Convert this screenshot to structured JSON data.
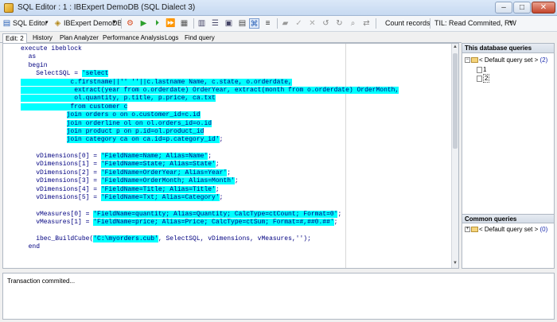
{
  "window": {
    "title": "SQL Editor : 1 : IBExpert DemoDB (SQL Dialect 3)",
    "min": "–",
    "max": "□",
    "close": "✕"
  },
  "toolbar": {
    "sql_editor_label": "SQL Editor",
    "db_combo": "IBExpert DemoDB",
    "count_records": "Count records",
    "til_label": "TIL: Read Commited, RW"
  },
  "tabs": [
    {
      "label": "Edit: 2"
    },
    {
      "label": "History"
    },
    {
      "label": "Plan Analyzer"
    },
    {
      "label": "Performance Analysis"
    },
    {
      "label": "Logs"
    },
    {
      "label": "Find query"
    }
  ],
  "code_lines": [
    {
      "pre": "execute ibeblock",
      "hl": "",
      "post": ""
    },
    {
      "pre": "  as",
      "hl": "",
      "post": ""
    },
    {
      "pre": "  begin",
      "hl": "",
      "post": ""
    },
    {
      "pre": "    SelectSQL = ",
      "hl": "'select",
      "post": ""
    },
    {
      "pre": "",
      "hl": "             c.firstname||'' ''||c.lastname Name, c.state, o.orderdate,",
      "post": ""
    },
    {
      "pre": "",
      "hl": "              extract(year from o.orderdate) OrderYear, extract(month from o.orderdate) OrderMonth,",
      "post": ""
    },
    {
      "pre": "",
      "hl": "              ol.quantity, p.title, p.price, ca.txt",
      "post": ""
    },
    {
      "pre": "",
      "hl": "             from customer c",
      "post": ""
    },
    {
      "pre": "            ",
      "hl": "join orders o on o.customer_id=c.id",
      "post": ""
    },
    {
      "pre": "            ",
      "hl": "join orderline ol on ol.orders_id=o.id",
      "post": ""
    },
    {
      "pre": "            ",
      "hl": "join product p on p.id=ol.product_id",
      "post": ""
    },
    {
      "pre": "            ",
      "hl": "join category ca on ca.id=p.category_id'",
      "post": ";"
    },
    {
      "pre": "",
      "hl": "",
      "post": ""
    },
    {
      "pre": "    vDimensions[0] = ",
      "hl": "'FieldName=Name; Alias=Name'",
      "post": ";"
    },
    {
      "pre": "    vDimensions[1] = ",
      "hl": "'FieldName=State; Alias=State'",
      "post": ";"
    },
    {
      "pre": "    vDimensions[2] = ",
      "hl": "'FieldName=OrderYear; Alias=Year'",
      "post": ";"
    },
    {
      "pre": "    vDimensions[3] = ",
      "hl": "'FieldName=OrderMonth; Alias=Month'",
      "post": ";"
    },
    {
      "pre": "    vDimensions[4] = ",
      "hl": "'FieldName=Title; Alias=Title'",
      "post": ";"
    },
    {
      "pre": "    vDimensions[5] = ",
      "hl": "'FieldName=Txt; Alias=Category'",
      "post": ";"
    },
    {
      "pre": "",
      "hl": "",
      "post": ""
    },
    {
      "pre": "    vMeasures[0] = ",
      "hl": "'FieldName=quantity; Alias=Quantity; CalcType=ctCount; Format=0'",
      "post": ";"
    },
    {
      "pre": "    vMeasures[1] = ",
      "hl": "'FieldName=price; Alias=Price; CalcType=ctSum; Format=#,##0.##'",
      "post": ";"
    },
    {
      "pre": "",
      "hl": "",
      "post": ""
    },
    {
      "pre": "    ibec_BuildCube(",
      "hl": "'C:\\myorders.cub'",
      "post": ", SelectSQL, vDimensions, vMeasures,''); "
    },
    {
      "pre": "  end",
      "hl": "",
      "post": ""
    }
  ],
  "right_panel": {
    "db_queries_header": "This database queries",
    "default_set_1": "< Default query set >",
    "default_set_1_count": "(2)",
    "items": [
      "1",
      "2"
    ],
    "common_queries_header": "Common queries",
    "default_set_2": "< Default query set >",
    "default_set_2_count": "(0)"
  },
  "status": {
    "message": "Transaction commited..."
  }
}
